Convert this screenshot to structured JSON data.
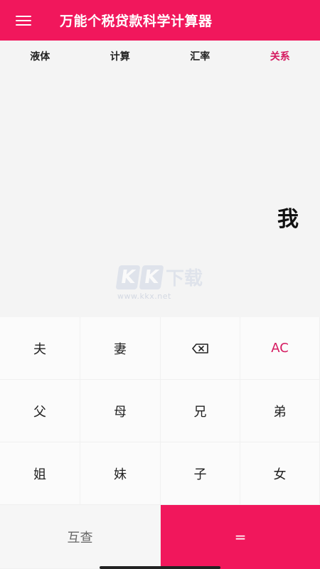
{
  "app": {
    "title": "万能个税贷款科学计算器"
  },
  "tabs": [
    {
      "label": "液体",
      "active": false
    },
    {
      "label": "计算",
      "active": false
    },
    {
      "label": "汇率",
      "active": false
    },
    {
      "label": "关系",
      "active": true
    }
  ],
  "display": {
    "result": "我"
  },
  "watermark": {
    "letters": [
      "K",
      "K"
    ],
    "cn": "下载",
    "url": "www.kkx.net"
  },
  "keys": {
    "husband": "夫",
    "wife": "妻",
    "clear": "AC",
    "father": "父",
    "mother": "母",
    "elder_brother": "兄",
    "younger_brother": "弟",
    "elder_sister": "姐",
    "younger_sister": "妹",
    "son": "子",
    "daughter": "女",
    "swap": "互查",
    "equals": "="
  },
  "colors": {
    "accent": "#f1175c",
    "accent_text": "#d5195f"
  }
}
